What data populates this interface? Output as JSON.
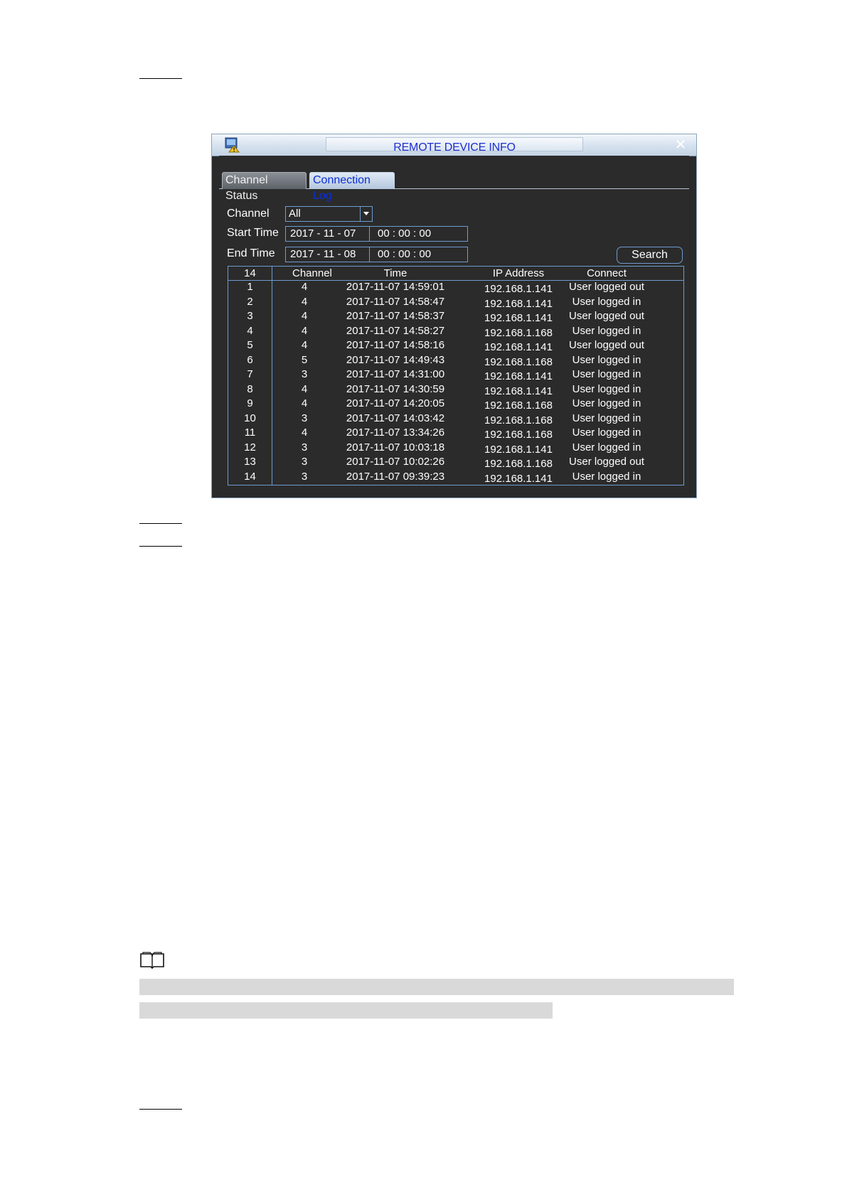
{
  "dialog": {
    "title": "REMOTE DEVICE INFO",
    "close_glyph": "✕",
    "tabs": [
      {
        "label": "Channel Status",
        "active": false
      },
      {
        "label": "Connection Log",
        "active": true
      }
    ],
    "filters": {
      "channel_label": "Channel",
      "channel_value": "All",
      "start_label": "Start Time",
      "start_date": "2017 - 11 - 07",
      "start_time": "00 : 00 : 00",
      "end_label": "End Time",
      "end_date": "2017 - 11 - 08",
      "end_time": "00 : 00 : 00",
      "search_label": "Search"
    },
    "table": {
      "headers": [
        "14",
        "Channel",
        "Time",
        "IP Address",
        "Connect"
      ],
      "rows": [
        [
          "1",
          "4",
          "2017-11-07 14:59:01",
          "192.168.1.141",
          "User logged out"
        ],
        [
          "2",
          "4",
          "2017-11-07 14:58:47",
          "192.168.1.141",
          "User logged in"
        ],
        [
          "3",
          "4",
          "2017-11-07 14:58:37",
          "192.168.1.141",
          "User logged out"
        ],
        [
          "4",
          "4",
          "2017-11-07 14:58:27",
          "192.168.1.168",
          "User logged in"
        ],
        [
          "5",
          "4",
          "2017-11-07 14:58:16",
          "192.168.1.141",
          "User logged out"
        ],
        [
          "6",
          "5",
          "2017-11-07 14:49:43",
          "192.168.1.168",
          "User logged in"
        ],
        [
          "7",
          "3",
          "2017-11-07 14:31:00",
          "192.168.1.141",
          "User logged in"
        ],
        [
          "8",
          "4",
          "2017-11-07 14:30:59",
          "192.168.1.141",
          "User logged in"
        ],
        [
          "9",
          "4",
          "2017-11-07 14:20:05",
          "192.168.1.168",
          "User logged in"
        ],
        [
          "10",
          "3",
          "2017-11-07 14:03:42",
          "192.168.1.168",
          "User logged in"
        ],
        [
          "11",
          "4",
          "2017-11-07 13:34:26",
          "192.168.1.168",
          "User logged in"
        ],
        [
          "12",
          "3",
          "2017-11-07 10:03:18",
          "192.168.1.141",
          "User logged in"
        ],
        [
          "13",
          "3",
          "2017-11-07 10:02:26",
          "192.168.1.168",
          "User logged out"
        ],
        [
          "14",
          "3",
          "2017-11-07 09:39:23",
          "192.168.1.141",
          "User logged in"
        ]
      ]
    }
  },
  "icons": [
    "app-icon",
    "close-icon",
    "dropdown-arrow-icon",
    "note-book-icon"
  ],
  "colors": {
    "title_text": "#1e2fd1",
    "window_bg": "#2a2a2a",
    "field_border": "#6f9bd0",
    "active_tab_text": "#0b2fd6",
    "note_highlight": "#d9d9d9"
  }
}
